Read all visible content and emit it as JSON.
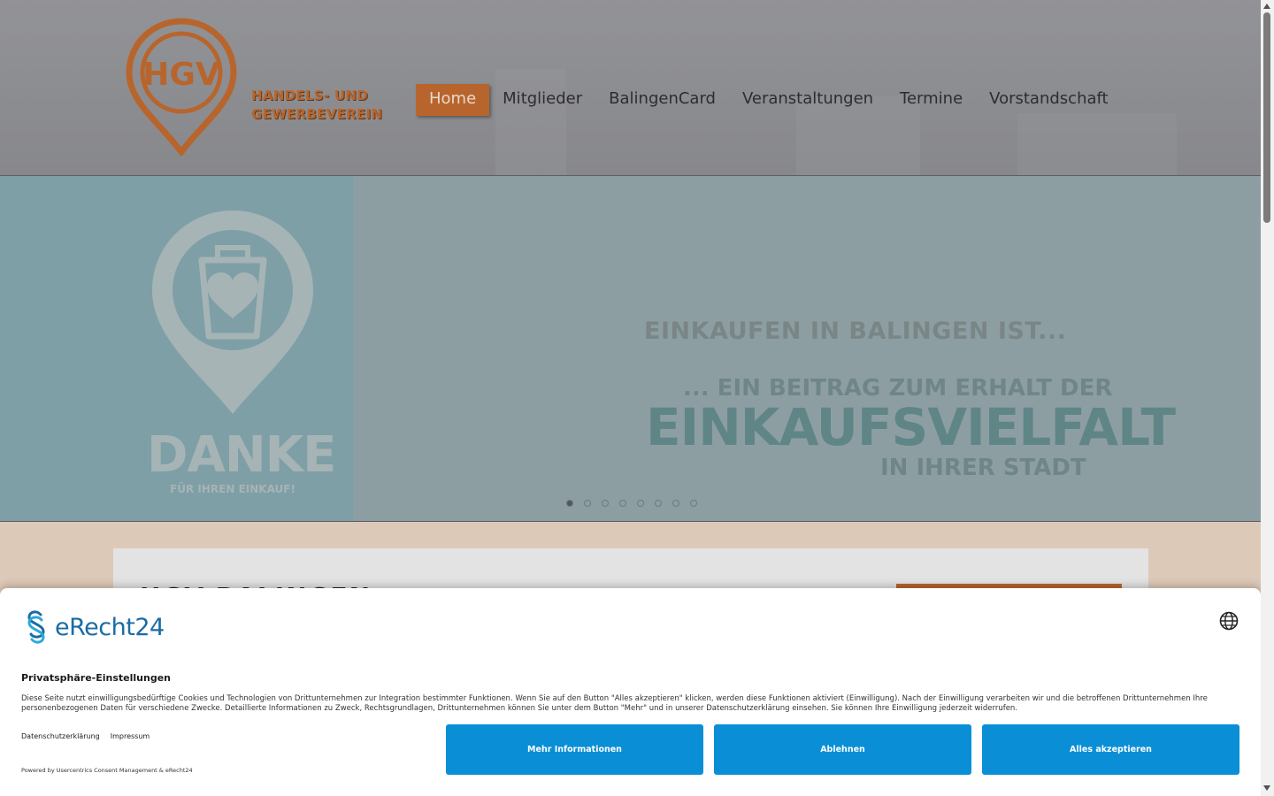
{
  "header": {
    "logo_abbr": "HGV",
    "logo_line1": "HANDELS- UND",
    "logo_line2": "GEWERBEVEREIN",
    "nav": [
      {
        "label": "Home",
        "active": true
      },
      {
        "label": "Mitglieder"
      },
      {
        "label": "BalingenCard"
      },
      {
        "label": "Veranstaltungen"
      },
      {
        "label": "Termine"
      },
      {
        "label": "Vorstandschaft"
      }
    ]
  },
  "slider": {
    "danke": "DANKE",
    "danke_sub": "FÜR IHREN EINKAUF!",
    "line1": "EINKAUFEN IN BALINGEN IST...",
    "line2": "... EIN BEITRAG ZUM ERHALT DER",
    "line3": "EINKAUFSVIELFALT",
    "line4": "IN IHRER STADT",
    "dots_total": 8,
    "active_dot": 1
  },
  "content": {
    "title": "HGV BALINGEN"
  },
  "consent": {
    "brand": "eRecht24",
    "title": "Privatsphäre-Einstellungen",
    "text": "Diese Seite nutzt einwilligungsbedürftige Cookies und Technologien von Drittunternehmen zur Integration bestimmter Funktionen. Wenn Sie auf den Button \"Alles akzeptieren\" klicken, werden diese Funktionen aktiviert (Einwilligung). Nach der Einwilligung verarbeiten wir und die betroffenen Drittunternehmen Ihre personenbezogenen Daten für verschiedene Zwecke. Detaillierte Informationen zu Zweck, Rechtsgrundlagen, Drittunternehmen können Sie unter dem Button \"Mehr\" und in unserer Datenschutzerklärung einsehen. Sie können Ihre Einwilligung jederzeit widerrufen.",
    "link_privacy": "Datenschutzerklärung",
    "link_imprint": "Impressum",
    "powered": "Powered by Usercentrics Consent Management & eRecht24",
    "btn_more": "Mehr Informationen",
    "btn_decline": "Ablehnen",
    "btn_accept": "Alles akzeptieren"
  },
  "colors": {
    "accent_orange": "#b8652d",
    "consent_button": "#0a8fd6"
  }
}
